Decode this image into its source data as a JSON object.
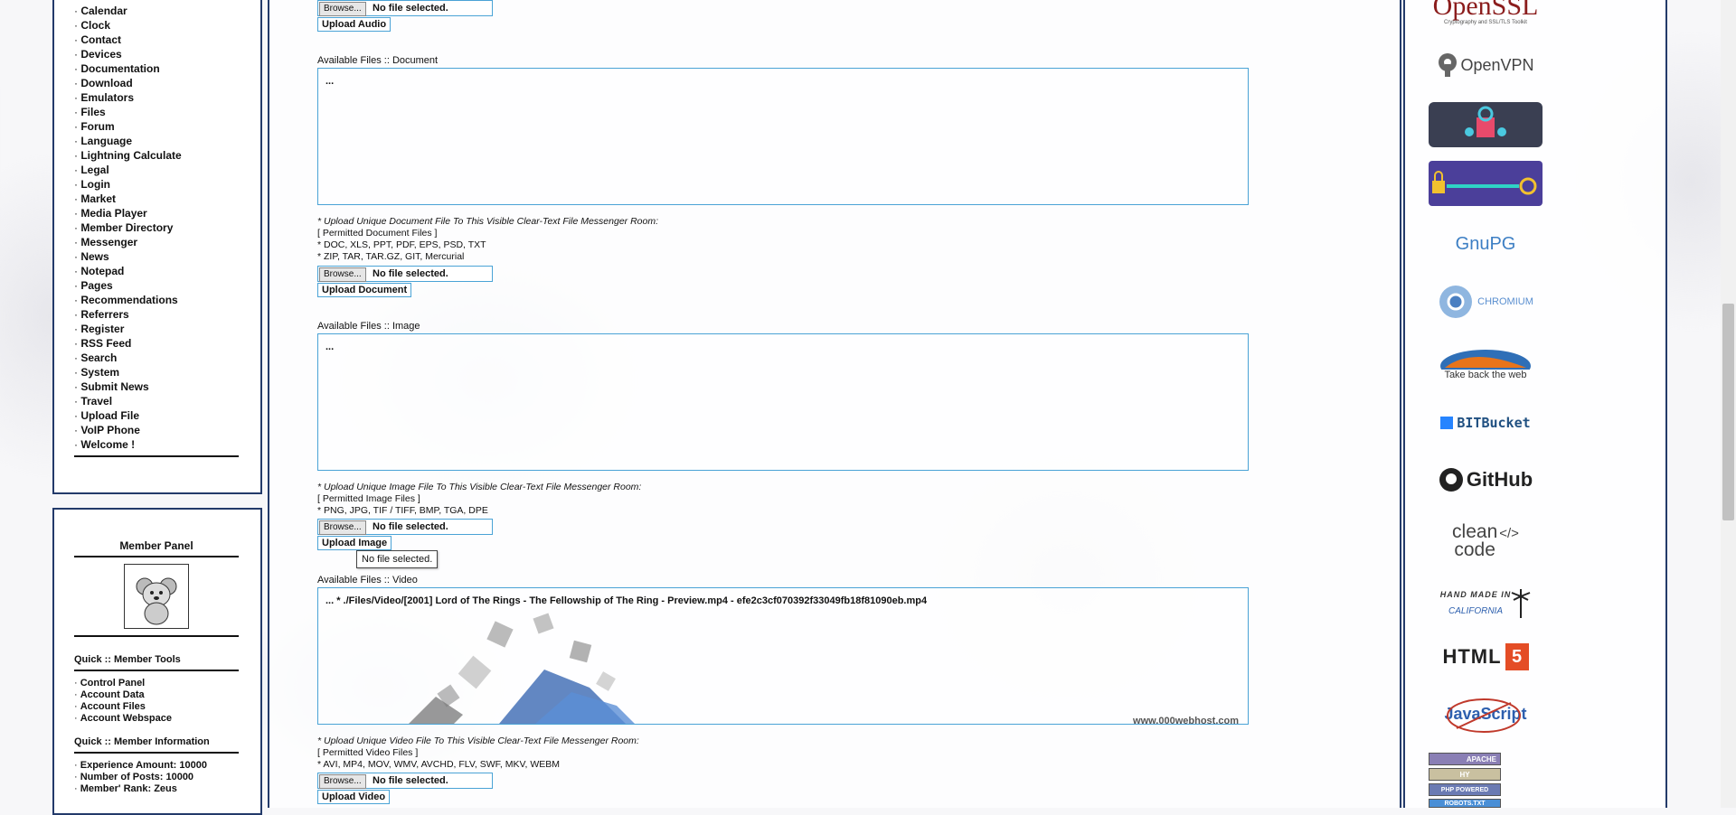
{
  "nav": {
    "items": [
      "Calendar",
      "Clock",
      "Contact",
      "Devices",
      "Documentation",
      "Download",
      "Emulators",
      "Files",
      "Forum",
      "Language",
      "Lightning Calculate",
      "Legal",
      "Login",
      "Market",
      "Media Player",
      "Member Directory",
      "Messenger",
      "News",
      "Notepad",
      "Pages",
      "Recommendations",
      "Referrers",
      "Register",
      "RSS Feed",
      "Search",
      "System",
      "Submit News",
      "Travel",
      "Upload File",
      "VoIP Phone",
      "Welcome !"
    ],
    "bullet": "·"
  },
  "member_panel": {
    "title": "Member Panel",
    "tools_title": "Quick :: Member Tools",
    "tools": [
      "Control Panel",
      "Account Data",
      "Account Files",
      "Account Webspace"
    ],
    "info_title": "Quick :: Member Information",
    "info": [
      "Experience Amount: 10000",
      "Number of Posts: 10000",
      "Member' Rank: Zeus"
    ]
  },
  "common": {
    "browse_label": "Browse...",
    "no_file_label": "No file selected.",
    "tooltip": "No file selected.",
    "available_prefix": "Available Files :: ",
    "empty_list": "...",
    "permitted_prefix": "* "
  },
  "audio": {
    "upload_label": "Upload Audio"
  },
  "document": {
    "title": "Document",
    "instruction": "* Upload Unique Document File To This Visible Clear-Text File Messenger Room:",
    "permitted_header": "[ Permitted Document Files ]",
    "permitted_1": "* DOC, XLS, PPT, PDF, EPS, PSD, TXT",
    "permitted_2": "* ZIP, TAR, TAR.GZ, GIT, Mercurial",
    "upload_label": "Upload Document"
  },
  "image": {
    "title": "Image",
    "instruction": "* Upload Unique Image File To This Visible Clear-Text File Messenger Room:",
    "permitted_header": "[ Permitted Image Files ]",
    "permitted_1": "* PNG, JPG, TIF / TIFF, BMP, TGA, DPE",
    "upload_label": "Upload Image"
  },
  "video": {
    "title": "Video",
    "file_entry": "... * ./Files/Video/[2001] Lord of The Rings - The Fellowship of The Ring - Preview.mp4 - efe2c3cf070392f33049fb18f81090eb.mp4",
    "watermark": "www.000webhost.com",
    "instruction": "* Upload Unique Video File To This Visible Clear-Text File Messenger Room:",
    "permitted_header": "[ Permitted Video Files ]",
    "permitted_1": "* AVI, MP4, MOV, WMV, AVCHD, FLV, SWF, MKV, WEBM",
    "upload_label": "Upload Video"
  },
  "logos": {
    "openssl": "OpenSSL",
    "openssl_sub": "Cryptography and SSL/TLS Toolkit",
    "openvpn": "OpenVPN",
    "gnupg": "GnuPG",
    "chromium": "CHROMIUM",
    "firefox": "Take back the web",
    "bitbucket": "BITBucket",
    "github": "GitHub",
    "cleancode_1": "clean",
    "cleancode_2": "code",
    "handmade": "HAND MADE IN",
    "california": "CALIFORNIA",
    "html5": "HTML",
    "html5_badge": "5",
    "javascript": "JavaScript",
    "apache": "APACHE",
    "hy": "HY",
    "php": "PHP POWERED",
    "robots": "ROBOTS.TXT"
  },
  "colors": {
    "border": "#233a6a",
    "accent": "#4aa3d6"
  }
}
